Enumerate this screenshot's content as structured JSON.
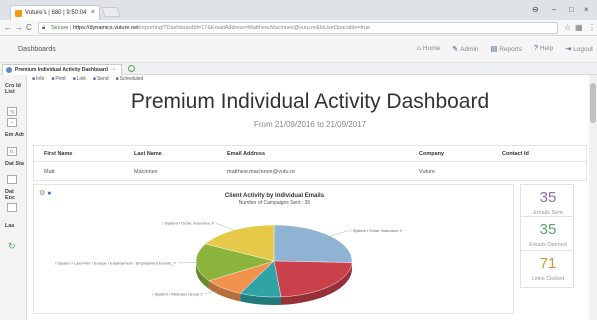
{
  "browser": {
    "tab_title": "Vuture's | 680 | 9:50:04",
    "tab_close": "×",
    "url_secure": "Secure",
    "url_host": "https://dynamics.vuture.net",
    "url_path": "/reporting/?DashboardId=17&EmailAddress=Matthew.Macinnes@vutu.re&IsUseOpacable=true",
    "min": "–",
    "max": "□",
    "close": "×"
  },
  "app": {
    "title": "Dashboards",
    "nav": [
      {
        "icon": "home-icon",
        "glyph": "⌂",
        "label": "Home"
      },
      {
        "icon": "admin-icon",
        "glyph": "✎",
        "label": "Admin"
      },
      {
        "icon": "reports-icon",
        "glyph": "▤",
        "label": "Reports"
      },
      {
        "icon": "help-icon",
        "glyph": "?",
        "label": "Help"
      },
      {
        "icon": "logout-icon",
        "glyph": "⇥",
        "label": "Logout"
      }
    ]
  },
  "page_tab": {
    "label": "Premium Individual Activity Dashboard",
    "close": "×"
  },
  "left_nav": [
    {
      "label": "Cro Id List"
    },
    {
      "label": "Em Adr"
    },
    {
      "label": "Dat Sta"
    },
    {
      "label": "Dat Enc"
    },
    {
      "label": "Las"
    }
  ],
  "toolbar": [
    {
      "icon": "info-icon",
      "label": "Info"
    },
    {
      "icon": "print-icon",
      "label": "Print"
    },
    {
      "icon": "link-icon",
      "label": "Link"
    },
    {
      "icon": "send-icon",
      "label": "Send"
    },
    {
      "icon": "schedule-icon",
      "label": "Scheduled"
    }
  ],
  "dashboard": {
    "title": "Premium Individual Activity Dashboard",
    "subtitle": "From 21/09/2016 to 21/09/2017"
  },
  "table": {
    "headers": [
      "First Name",
      "Last Name",
      "Email Address",
      "Company",
      "Contact Id"
    ],
    "rows": [
      [
        "Matt",
        "Macinnes",
        "matthew.macinnes@vutu.re",
        "Vuture",
        ""
      ]
    ]
  },
  "chart_data": {
    "type": "pie",
    "title": "Client Activity by Individual Emails",
    "subtitle": "Number of Campaigns Sent : 35",
    "slices": [
      {
        "label": "/ System / Ocwe Insurance X",
        "value": 9,
        "color": "#8fb3d3"
      },
      {
        "label": "",
        "value": 8,
        "color": "#c9414b"
      },
      {
        "label": "",
        "value": 3,
        "color": "#2fa3a6"
      },
      {
        "label": "/ System / Webuser Group 2",
        "value": 3,
        "color": "#f2934d"
      },
      {
        "label": "/ System / Law Firm / Europe / Employment / Employment Events_Y",
        "value": 6,
        "color": "#8cb43c"
      },
      {
        "label": "/ System / Ocwe Insurance X",
        "value": 6,
        "color": "#e7c94a"
      }
    ]
  },
  "stats": [
    {
      "value": "35",
      "label": "Emails Sent",
      "color": "#8b6fa8"
    },
    {
      "value": "35",
      "label": "Emails Opened",
      "color": "#5aa66a"
    },
    {
      "value": "71",
      "label": "Links Clicked",
      "color": "#c79a3a"
    }
  ]
}
